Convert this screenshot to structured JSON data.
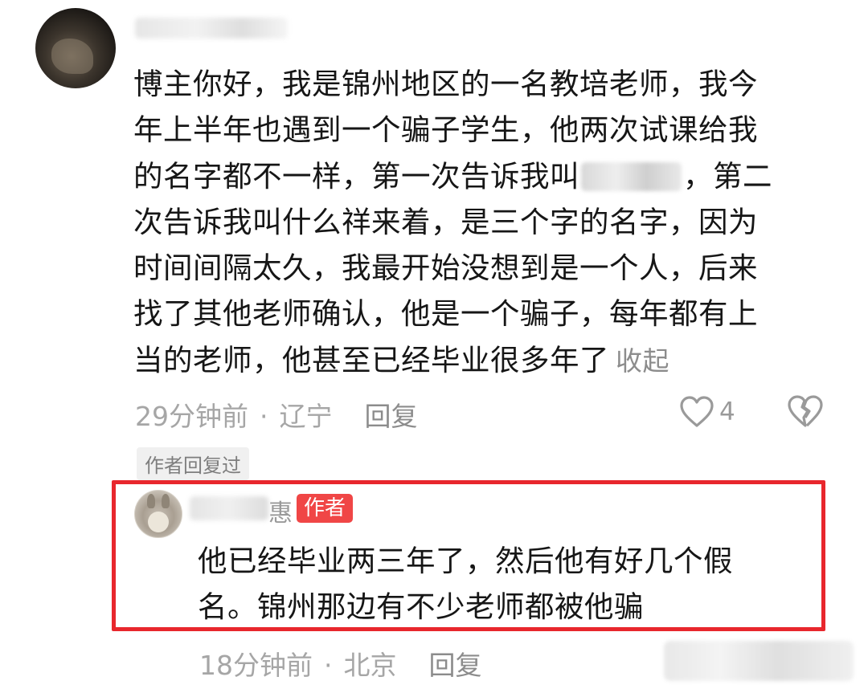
{
  "comment": {
    "lines": [
      "博主你好，我是锦州地区的一名教培老师，我今",
      "年上半年也遇到一个骗子学生，他两次试课给我",
      "的名字都不一样，第一次告诉我叫",
      "，第二",
      "次告诉我叫什么祥来着，是三个字的名字，因为",
      "时间间隔太久，我最开始没想到是一个人，后来",
      "找了其他老师确认，他是一个骗子，每年都有上",
      "当的老师，他甚至已经毕业很多年了"
    ],
    "collapse_label": "收起",
    "time": "29分钟前",
    "separator": "·",
    "location": "辽宁",
    "reply_label": "回复",
    "like_count": "4",
    "author_replied_tag": "作者回复过"
  },
  "reply": {
    "name_visible_tail": "惠",
    "author_badge": "作者",
    "lines": [
      "他已经毕业两三年了，然后他有好几个假",
      "名。锦州那边有不少老师都被他骗"
    ],
    "time": "18分钟前",
    "separator": "·",
    "location": "北京",
    "reply_label": "回复"
  },
  "colors": {
    "highlight_border": "#e8272d",
    "author_badge_bg": "#f04646"
  }
}
